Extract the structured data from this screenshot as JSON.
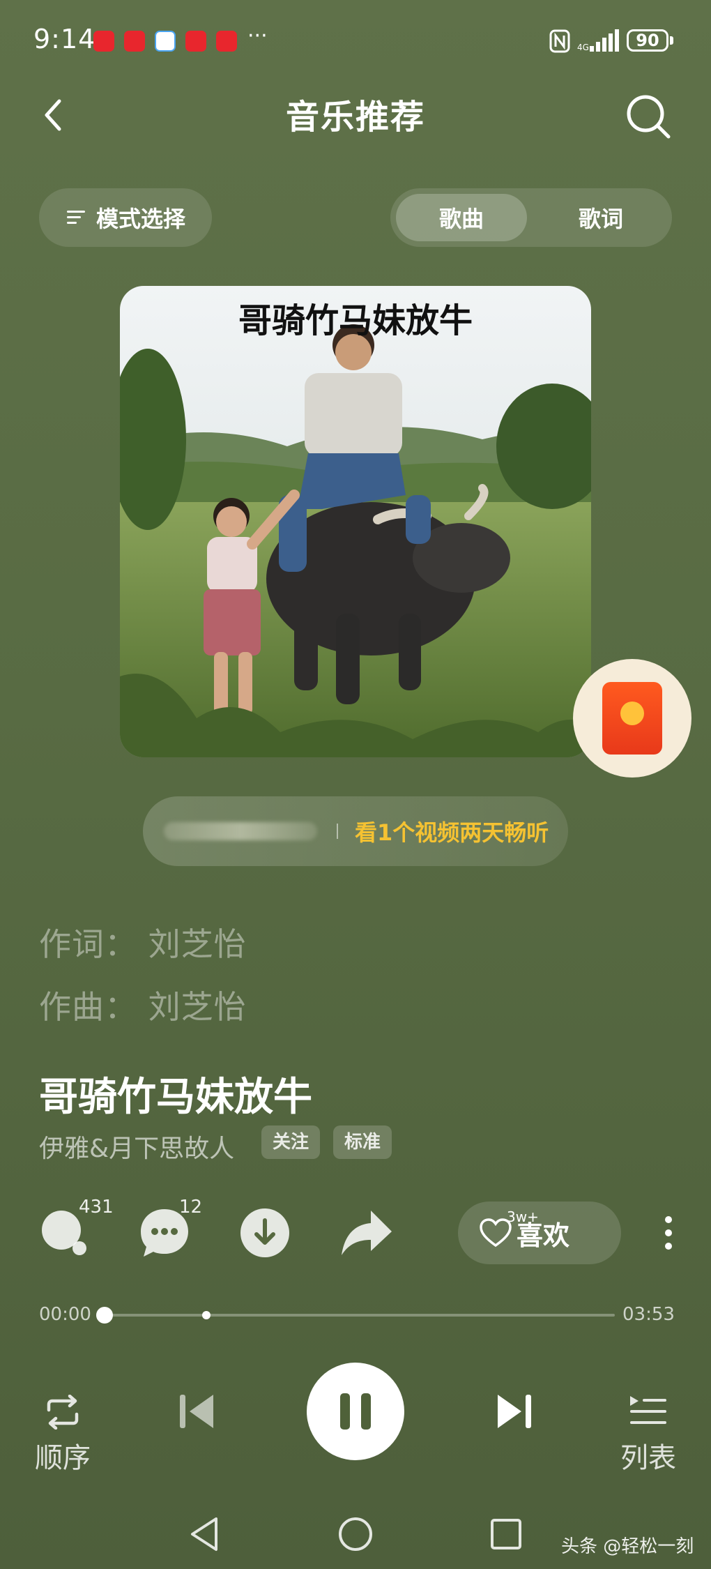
{
  "status_bar": {
    "time": "9:14",
    "overflow": "···",
    "battery": "90",
    "notification_colors": [
      "#e8262d",
      "#e8262d",
      "#4aa4f0",
      "#e8262d",
      "#e8262d"
    ]
  },
  "header": {
    "title": "音乐推荐",
    "back_icon": "chevron-left-icon",
    "search_icon": "search-icon"
  },
  "mode": {
    "label": "模式选择"
  },
  "tabs": [
    {
      "label": "歌曲",
      "active": true
    },
    {
      "label": "歌词",
      "active": false
    }
  ],
  "cover": {
    "title": "哥骑竹马妹放牛"
  },
  "promo": {
    "text": "看1个视频两天畅听"
  },
  "credits": {
    "lyricist": "作词：  刘芝怡",
    "composer": "作曲：  刘芝怡"
  },
  "song": {
    "title": "哥骑竹马妹放牛",
    "artist": "伊雅&月下思故人",
    "follow_tag": "关注",
    "quality_tag": "标准"
  },
  "actions": {
    "search_count": "431",
    "comment_count": "12",
    "like_count": "3w+",
    "like_label": "喜欢"
  },
  "progress": {
    "current": "00:00",
    "total": "03:53",
    "played_fraction": 0.0,
    "buffered_fraction": 0.2
  },
  "controls": {
    "repeat_label": "顺序",
    "playlist_label": "列表"
  },
  "watermark": "头条 @轻松一刻",
  "colors": {
    "accent_yellow": "#f5c232",
    "background": "#5a6c44"
  }
}
